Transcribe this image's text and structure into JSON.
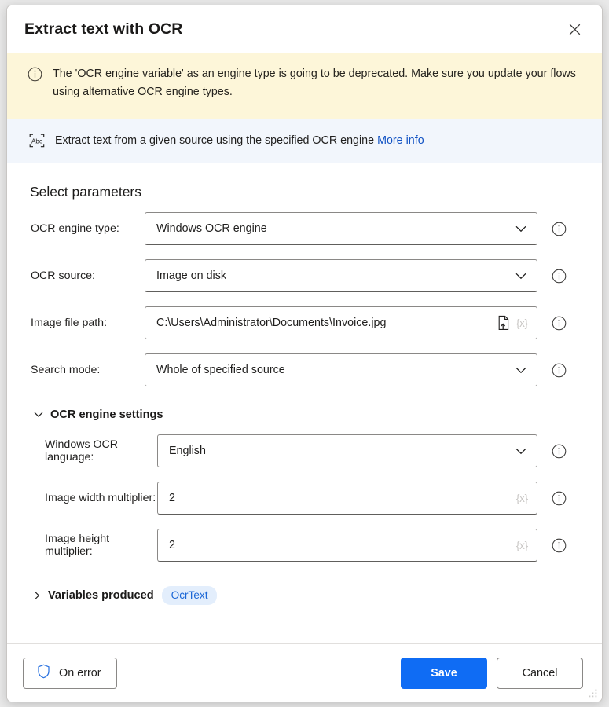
{
  "dialog": {
    "title": "Extract text with OCR",
    "close_label": "Close"
  },
  "warning": {
    "icon": "info-circle-icon",
    "text": "The 'OCR engine variable' as an engine type is going to be deprecated.  Make sure you update your flows using alternative OCR engine types."
  },
  "description": {
    "icon": "abc-scan-icon",
    "text": "Extract text from a given source using the specified OCR engine",
    "link_label": "More info"
  },
  "main": {
    "section_title": "Select parameters",
    "fields": [
      {
        "label": "OCR engine type:",
        "value": "Windows OCR engine",
        "control": "dropdown"
      },
      {
        "label": "OCR source:",
        "value": "Image on disk",
        "control": "dropdown"
      },
      {
        "label": "Image file path:",
        "value": "C:\\Users\\Administrator\\Documents\\Invoice.jpg",
        "control": "textfield",
        "file_picker": "file-upload-icon",
        "variable_token": "{x}"
      },
      {
        "label": "Search mode:",
        "value": "Whole of specified source",
        "control": "dropdown"
      }
    ],
    "engine_settings": {
      "title": "OCR engine settings",
      "expanded": true,
      "fields": [
        {
          "label": "Windows OCR language:",
          "value": "English",
          "control": "dropdown"
        },
        {
          "label": "Image width multiplier:",
          "value": "2",
          "control": "textfield",
          "variable_token": "{x}"
        },
        {
          "label": "Image height multiplier:",
          "value": "2",
          "control": "textfield",
          "variable_token": "{x}"
        }
      ]
    },
    "variables_produced": {
      "title": "Variables produced",
      "expanded": false,
      "pill": "OcrText"
    }
  },
  "footer": {
    "on_error_label": "On error",
    "on_error_icon": "shield-icon",
    "save_label": "Save",
    "cancel_label": "Cancel"
  },
  "colors": {
    "accent": "#0f6cf4",
    "warning_bg": "#fdf6d9",
    "info_bg": "#f2f6fc",
    "link": "#1253c4",
    "pill_bg": "#e3eefc",
    "pill_text": "#1a66d6"
  }
}
